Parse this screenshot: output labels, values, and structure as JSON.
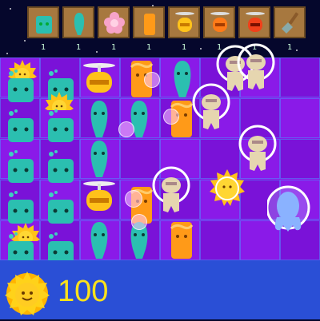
{
  "seed_bar": {
    "seeds": [
      {
        "name": "teal-square-plant",
        "count": "1"
      },
      {
        "name": "teal-ghost-plant",
        "count": "1"
      },
      {
        "name": "pink-flower-plant",
        "count": "1"
      },
      {
        "name": "orange-tower-plant",
        "count": "1"
      },
      {
        "name": "yellow-copter-plant",
        "count": "1"
      },
      {
        "name": "orange-copter-plant",
        "count": "1"
      },
      {
        "name": "red-copter-plant",
        "count": "1"
      },
      {
        "name": "shovel",
        "count": "1"
      }
    ]
  },
  "sun": {
    "value": "100"
  },
  "colors": {
    "board": "#8a1ae8",
    "water": "#2a4fd6",
    "sun_text": "#ffe21a",
    "grid": "#5a8cff"
  }
}
